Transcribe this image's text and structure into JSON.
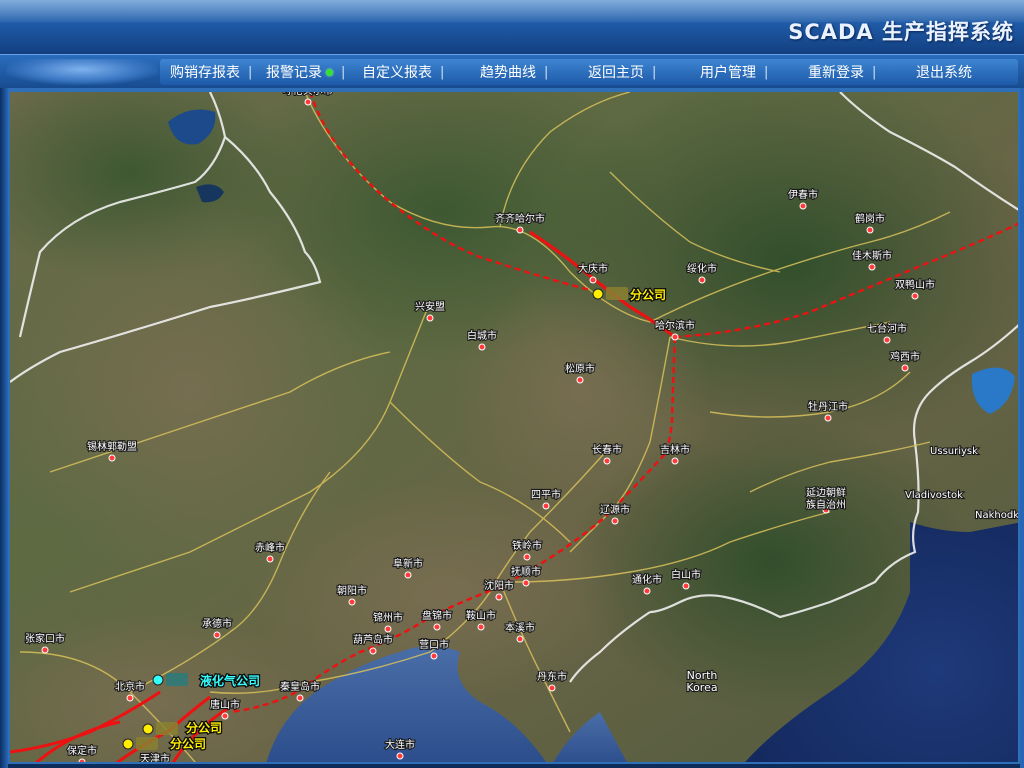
{
  "app_title": "SCADA 生产指挥系统",
  "nav_items": [
    {
      "label": "购销存报表"
    },
    {
      "label": "报警记录"
    },
    {
      "label": "自定义报表"
    },
    {
      "label": "趋势曲线"
    },
    {
      "label": "返回主页"
    },
    {
      "label": "用户管理"
    },
    {
      "label": "重新登录"
    },
    {
      "label": "退出系统"
    }
  ],
  "colors": {
    "pipeline": "#ee1111",
    "company_yellow": "#ffee00",
    "company_cyan": "#33ffff",
    "status_dot": "#35e035"
  },
  "map": {
    "cities": [
      {
        "name": "呼伦贝尔市"
      },
      {
        "name": "齐齐哈尔市"
      },
      {
        "name": "伊春市"
      },
      {
        "name": "鹤岗市"
      },
      {
        "name": "佳木斯市"
      },
      {
        "name": "绥化市"
      },
      {
        "name": "大庆市"
      },
      {
        "name": "双鸭山市"
      },
      {
        "name": "兴安盟"
      },
      {
        "name": "哈尔滨市"
      },
      {
        "name": "七台河市"
      },
      {
        "name": "白城市"
      },
      {
        "name": "鸡西市"
      },
      {
        "name": "松原市"
      },
      {
        "name": "牡丹江市"
      },
      {
        "name": "锡林郭勒盟"
      },
      {
        "name": "长春市"
      },
      {
        "name": "吉林市"
      },
      {
        "name": "Ussuriysk"
      },
      {
        "name": "四平市"
      },
      {
        "name": "Vladivostok"
      },
      {
        "name": "辽源市"
      },
      {
        "name": "延边朝鲜族自治州"
      },
      {
        "name": "Nakhodka"
      },
      {
        "name": "铁岭市"
      },
      {
        "name": "赤峰市"
      },
      {
        "name": "阜新市"
      },
      {
        "name": "抚顺市"
      },
      {
        "name": "通化市"
      },
      {
        "name": "白山市"
      },
      {
        "name": "朝阳市"
      },
      {
        "name": "沈阳市"
      },
      {
        "name": "锦州市"
      },
      {
        "name": "盘锦市"
      },
      {
        "name": "鞍山市"
      },
      {
        "name": "承德市"
      },
      {
        "name": "本溪市"
      },
      {
        "name": "张家口市"
      },
      {
        "name": "葫芦岛市"
      },
      {
        "name": "营口市"
      },
      {
        "name": "丹东市"
      },
      {
        "name": "North Korea"
      },
      {
        "name": "北京市"
      },
      {
        "name": "秦皇岛市"
      },
      {
        "name": "唐山市"
      },
      {
        "name": "保定市"
      },
      {
        "name": "天津市"
      },
      {
        "name": "大连市"
      }
    ],
    "companies": [
      {
        "label": "分公司",
        "color": "yellow"
      },
      {
        "label": "液化气公司",
        "color": "cyan"
      },
      {
        "label": "分公司",
        "color": "yellow"
      },
      {
        "label": "分公司",
        "color": "yellow"
      }
    ]
  }
}
